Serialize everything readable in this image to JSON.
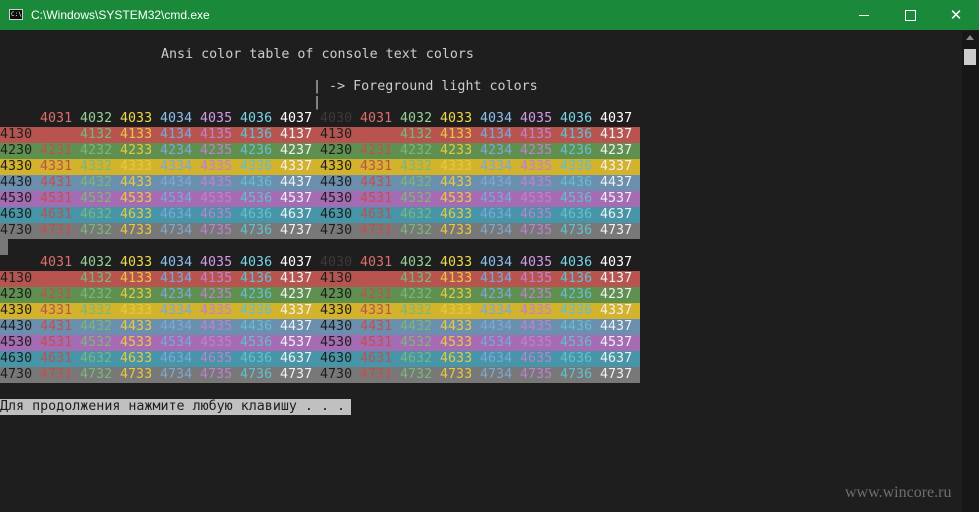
{
  "window": {
    "title": "C:\\Windows\\SYSTEM32\\cmd.exe",
    "icon_text": "C:\\",
    "title_bar_color": "#1a8a3a"
  },
  "console": {
    "heading": "Ansi color table of console text colors",
    "subheading": "| -> Foreground light colors",
    "pipe_line": "|",
    "prompt": "Для продолжения нажмите любую клавишу . . .",
    "header_labels": [
      "4031",
      "4032",
      "4033",
      "4034",
      "4035",
      "4036",
      "4037"
    ],
    "header_first_dark": "4030",
    "rows": [
      {
        "bg": "#b85450",
        "codes": [
          "4130",
          "4131",
          "4132",
          "4133",
          "4134",
          "4135",
          "4136",
          "4137"
        ]
      },
      {
        "bg": "#60904f",
        "codes": [
          "4230",
          "4231",
          "4232",
          "4233",
          "4234",
          "4235",
          "4236",
          "4237"
        ]
      },
      {
        "bg": "#d3b22c",
        "codes": [
          "4330",
          "4331",
          "4332",
          "4333",
          "4334",
          "4335",
          "4336",
          "4337"
        ]
      },
      {
        "bg": "#6b8fae",
        "codes": [
          "4430",
          "4431",
          "4432",
          "4433",
          "4434",
          "4435",
          "4436",
          "4437"
        ]
      },
      {
        "bg": "#a56cb3",
        "codes": [
          "4530",
          "4531",
          "4532",
          "4533",
          "4534",
          "4535",
          "4536",
          "4537"
        ]
      },
      {
        "bg": "#4795a8",
        "codes": [
          "4630",
          "4631",
          "4632",
          "4633",
          "4634",
          "4635",
          "4636",
          "4637"
        ]
      },
      {
        "bg": "#787878",
        "codes": [
          "4730",
          "4731",
          "4732",
          "4733",
          "4734",
          "4735",
          "4736",
          "4737"
        ]
      }
    ],
    "fg_colors": [
      "#1e1e1e",
      "#c05050",
      "#7ab87a",
      "#e8c840",
      "#7aa8d8",
      "#c080d0",
      "#60c0d0",
      "#f0f0f0"
    ],
    "header_fg": [
      "#3a3a3a",
      "#e06c6c",
      "#98d098",
      "#f0d84a",
      "#8cc0f0",
      "#d69ae8",
      "#7ad6e6",
      "#ffffff"
    ]
  },
  "watermark": "www.wincore.ru"
}
